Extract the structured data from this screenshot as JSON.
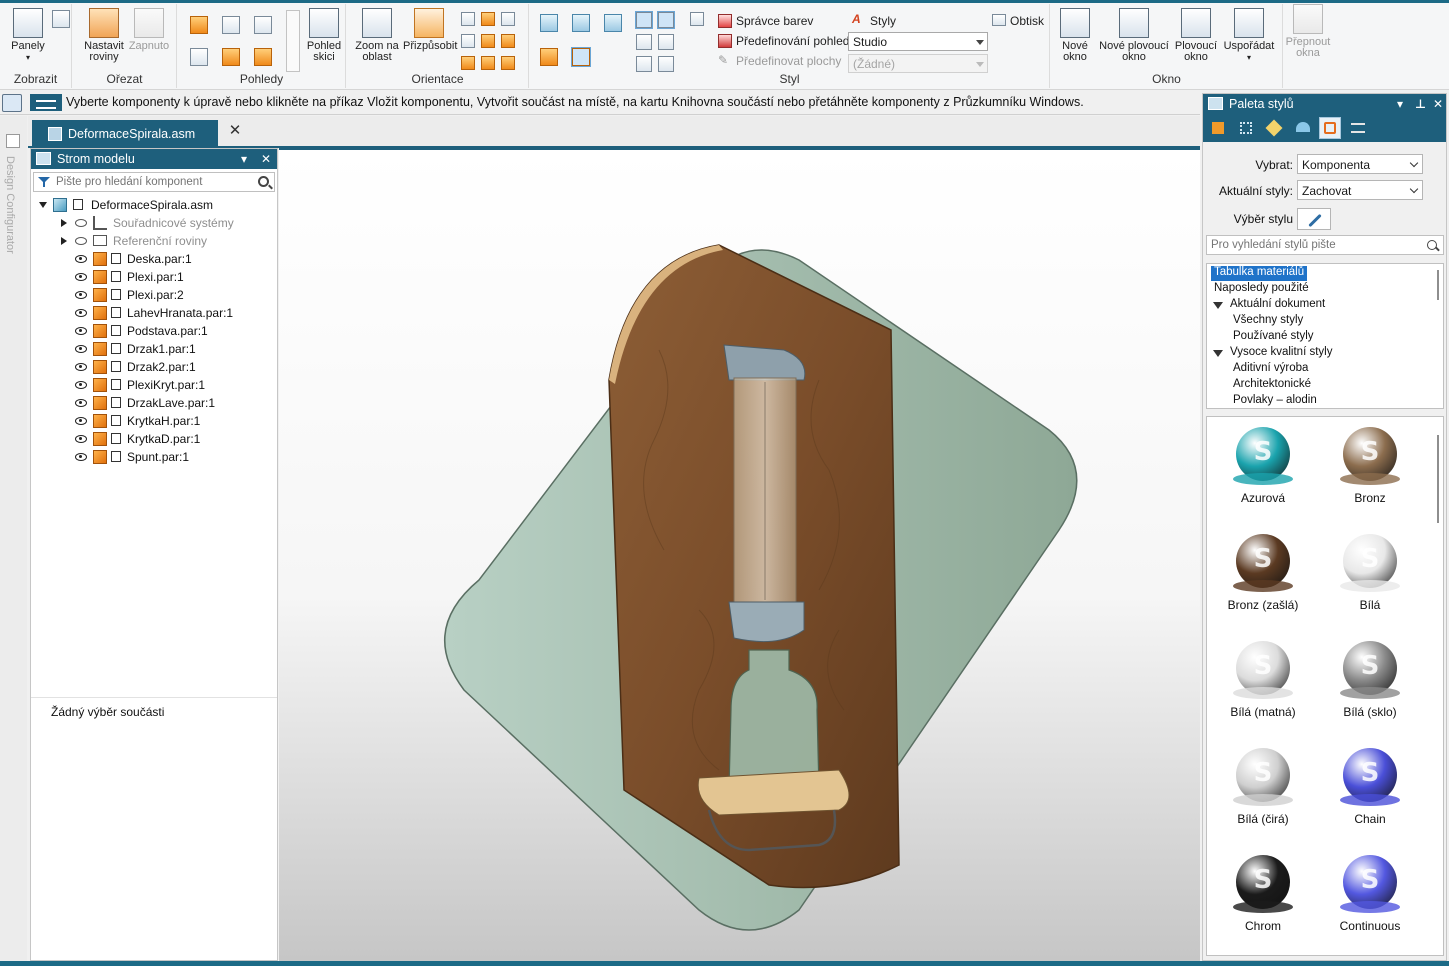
{
  "ribbon": {
    "groups": {
      "zobrazit": "Zobrazit",
      "oriznout": "Ořezat",
      "pohledy": "Pohledy",
      "orientace": "Orientace",
      "styl": "Styl",
      "okno": "Okno"
    },
    "buttons": {
      "panely": "Panely",
      "nastavit_roviny": "Nastavit roviny",
      "zapnuto": "Zapnuto",
      "pohled_skici": "Pohled skici",
      "zoom_na_oblast": "Zoom na oblast",
      "prizpusobit": "Přizpůsobit",
      "spravce_barev": "Správce barev",
      "predefinovani_pohledu": "Předefinování pohledů",
      "predefinovat_plochy": "Předefinovat plochy",
      "styly": "Styly",
      "obtisk": "Obtisk",
      "nove_okno": "Nové okno",
      "nove_plovouci_okno": "Nové plovoucí okno",
      "plovouci_okno": "Plovoucí okno",
      "usporadat": "Uspořádat",
      "prepnout_okna": "Přepnout okna"
    },
    "combos": {
      "studio": "Studio",
      "zadne": "(Žádné)"
    }
  },
  "prompt": {
    "text": "Vyberte komponenty k úpravě nebo klikněte na příkaz Vložit komponentu, Vytvořit součást na místě, na kartu Knihovna součástí nebo přetáhněte komponenty z Průzkumníku Windows."
  },
  "left_strip": {
    "label": "Design Configurator"
  },
  "document": {
    "tab_label": "DeformaceSpirala.asm"
  },
  "model_tree": {
    "title": "Strom modelu",
    "search_placeholder": "Pište pro hledání komponent",
    "root": "DeformaceSpirala.asm",
    "folders": [
      "Souřadnicové systémy",
      "Referenční roviny"
    ],
    "parts": [
      "Deska.par:1",
      "Plexi.par:1",
      "Plexi.par:2",
      "LahevHranata.par:1",
      "Podstava.par:1",
      "Drzak1.par:1",
      "Drzak2.par:1",
      "PlexiKryt.par:1",
      "DrzakLave.par:1",
      "KrytkaH.par:1",
      "KrytkaD.par:1",
      "Spunt.par:1"
    ],
    "no_selection": "Žádný výběr součásti"
  },
  "style_palette": {
    "title": "Paleta stylů",
    "vybrat_label": "Vybrat:",
    "vybrat_value": "Komponenta",
    "aktualni_label": "Aktuální styly:",
    "aktualni_value": "Zachovat",
    "vyber_stylu_label": "Výběr stylu",
    "search_placeholder": "Pro vyhledání stylů pište",
    "list": {
      "tabulka": "Tabulka materiálů",
      "naposledy": "Naposledy použité",
      "aktualni_dokument": "Aktuální dokument",
      "vsechny": "Všechny styly",
      "pouzivane": "Používané styly",
      "vysoce": "Vysoce kvalitní styly",
      "aditivni": "Aditivní výroba",
      "architektonicke": "Architektonické",
      "povlaky": "Povlaky – alodin"
    },
    "swatches": [
      {
        "name": "Azurová",
        "color": "#1aa3ad"
      },
      {
        "name": "Bronz",
        "color": "#8c6d4e"
      },
      {
        "name": "Bronz (zašlá)",
        "color": "#5b3a22"
      },
      {
        "name": "Bílá",
        "color": "#e8e8e8"
      },
      {
        "name": "Bílá (matná)",
        "color": "#dcdcdc"
      },
      {
        "name": "Bílá (sklo)",
        "color": "#8a8a8a"
      },
      {
        "name": "Bílá (čirá)",
        "color": "#cfcfcf"
      },
      {
        "name": "Chain",
        "color": "#4a4fd8"
      },
      {
        "name": "Chrom",
        "color": "#1b1b1b"
      },
      {
        "name": "Continuous",
        "color": "#5358e0"
      }
    ]
  }
}
